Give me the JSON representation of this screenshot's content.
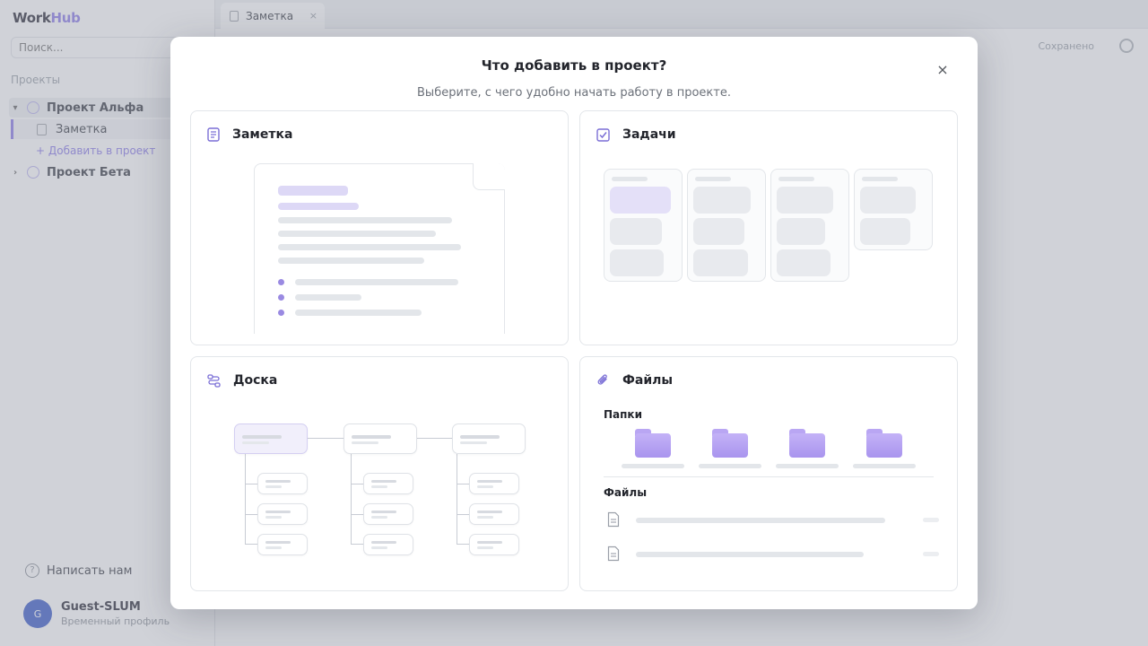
{
  "app": {
    "logo_main": "Work",
    "logo_accent": "Hub",
    "search_placeholder": "Поиск...",
    "projects_heading": "Проекты",
    "tree": {
      "project_alpha": "Проект Альфа",
      "note_item": "Заметка",
      "add_to_project": "+ Добавить в проект",
      "project_beta": "Проект Бета"
    },
    "write_us": "Написать нам",
    "user": {
      "initial": "G",
      "name": "Guest-SLUM",
      "subtitle": "Временный профиль"
    },
    "tab": {
      "label": "Заметка",
      "close": "×"
    },
    "status": "Сохранено"
  },
  "modal": {
    "title": "Что добавить в проект?",
    "subtitle": "Выберите, с чего удобно начать работу в проекте.",
    "close_symbol": "×",
    "options": [
      {
        "title": "Заметка",
        "icon": "note-icon"
      },
      {
        "title": "Задачи",
        "icon": "checkbox-icon"
      },
      {
        "title": "Доска",
        "icon": "board-flow-icon"
      },
      {
        "title": "Файлы",
        "icon": "paperclip-icon"
      }
    ],
    "files_preview": {
      "folders_label": "Папки",
      "files_label": "Файлы"
    }
  },
  "colors": {
    "accent": "#8a7be8",
    "overlay": "rgba(150,156,168,0.45)"
  }
}
